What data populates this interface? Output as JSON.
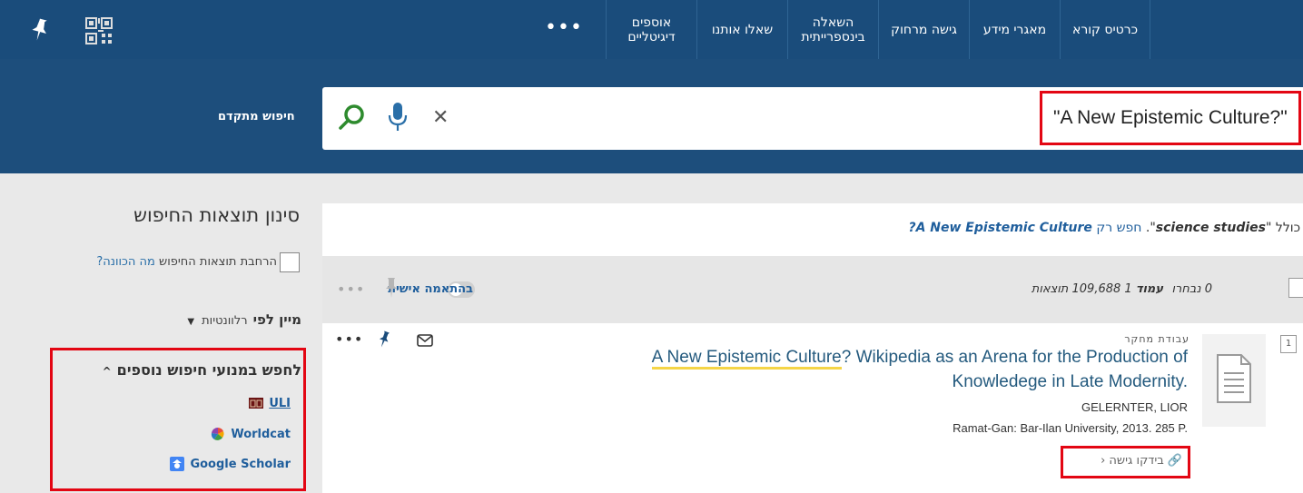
{
  "nav": {
    "items": [
      {
        "id": "reader-card",
        "label": "כרטיס קורא"
      },
      {
        "id": "databases",
        "label": "מאגרי מידע"
      },
      {
        "id": "remote-access",
        "label": "גישה מרחוק"
      },
      {
        "id": "interlibrary-loan",
        "label": "השאלה בינספרייתית"
      },
      {
        "id": "ask-us",
        "label": "שאלו אותנו"
      },
      {
        "id": "digital-collections",
        "label": "אוספים דיגיטליים"
      }
    ],
    "more": "•••",
    "icons": {
      "pin": "pin-icon",
      "qr": "qr-code-icon"
    }
  },
  "search": {
    "query": "\"A New Epistemic Culture?\"",
    "advanced_label": "חיפוש מתקדם",
    "icons": {
      "search": "magnifier-icon",
      "mic": "microphone-icon",
      "clear": "close-icon"
    },
    "clear_glyph": "✕"
  },
  "filter": {
    "title": "סינון תוצאות החיפוש",
    "expand_label": "הרחבת תוצאות החיפוש",
    "expand_link": "מה הכוונה?",
    "sort_label": "מיין לפי",
    "sort_value": "רלוונטיות",
    "sort_caret": "▼",
    "external": {
      "title": "לחפש במנועי חיפוש נוספים",
      "chevron": "^",
      "links": [
        {
          "id": "uli",
          "label": "ULI"
        },
        {
          "id": "worldcat",
          "label": "Worldcat"
        },
        {
          "id": "google-scholar",
          "label": "Google Scholar"
        }
      ]
    }
  },
  "results": {
    "didyoumean": {
      "prefix": "כולל \"",
      "query_term": "science studies",
      "mid": "\". ",
      "only_label": "חפש רק",
      "suggestion": "A New Epistemic Culture?"
    },
    "toolbar": {
      "selected": "0 נבחרו",
      "page_label": "עמוד",
      "page_number": "1",
      "result_count": "109,688 תוצאות",
      "personalize": "בהתאמה אישית",
      "more": "•••"
    },
    "items": [
      {
        "number": "1",
        "type": "עבודת מחקר",
        "title_highlight": "A New Epistemic Culture",
        "title_rest": "? Wikipedia as an Arena for the Production of Knowledege in Late Modernity.",
        "author": "GELERNTER, LIOR",
        "publisher": "Ramat-Gan: Bar-Ilan University, 2013. 285 P.",
        "access_label": "בידקו גישה",
        "access_arrow": "‹",
        "access_clip": "🔗",
        "actions_more": "•••"
      }
    ]
  },
  "colors": {
    "primary": "#1a4c7b",
    "link": "#1f5e9c",
    "highlight_box": "#e30613",
    "search_icon": "#2e8b2e",
    "mic_icon": "#2a6fa8",
    "title": "#245a7e"
  }
}
